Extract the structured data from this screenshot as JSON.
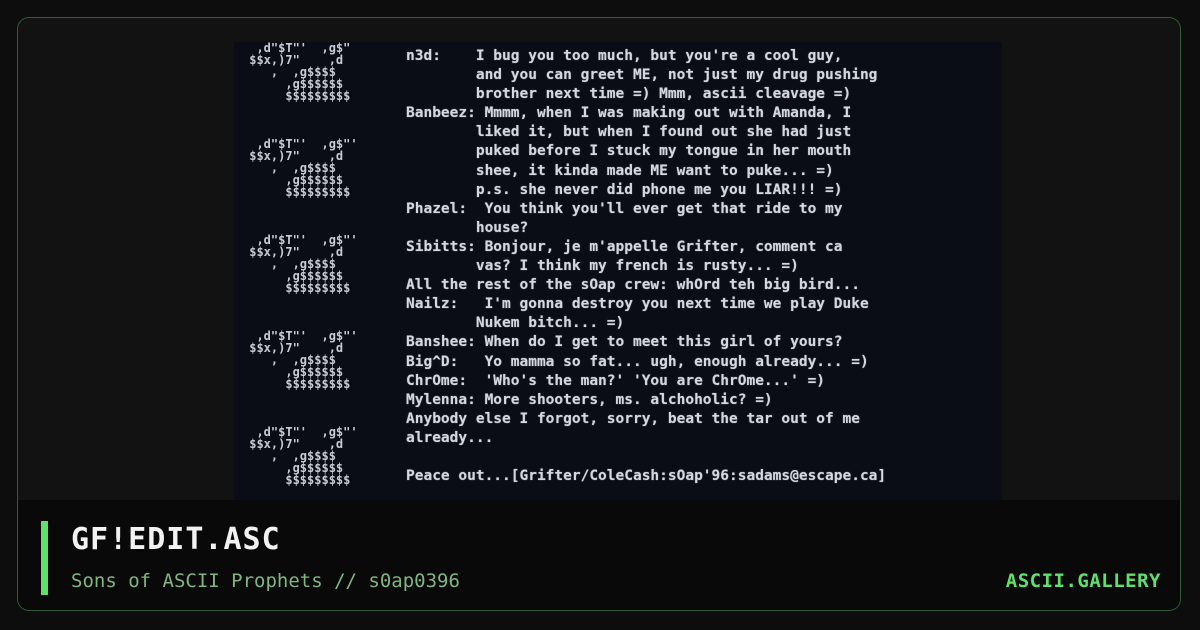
{
  "artwork": {
    "lines": [
      "n3d:    I bug you too much, but you're a cool guy,",
      "        and you can greet ME, not just my drug pushing",
      "        brother next time =) Mmm, ascii cleavage =)",
      "Banbeez: Mmmm, when I was making out with Amanda, I",
      "        liked it, but when I found out she had just",
      "        puked before I stuck my tongue in her mouth",
      "        shee, it kinda made ME want to puke... =)",
      "        p.s. she never did phone me you LIAR!!! =)",
      "Phazel:  You think you'll ever get that ride to my",
      "        house?",
      "Sibitts: Bonjour, je m'appelle Grifter, comment ca",
      "        vas? I think my french is rusty... =)",
      "All the rest of the sOap crew: whOrd teh big bird...",
      "Nailz:   I'm gonna destroy you next time we play Duke",
      "        Nukem bitch... =)",
      "Banshee: When do I get to meet this girl of yours?",
      "Big^D:   Yo mamma so fat... ugh, enough already... =)",
      "ChrOme:  'Who's the man?' 'You are ChrOme...' =)",
      "Mylenna: More shooters, ms. alchoholic? =)",
      "Anybody else I forgot, sorry, beat the tar out of me",
      "already...",
      "",
      "Peace out...[Grifter/ColeCash:sOap'96:sadams@escape.ca]"
    ]
  },
  "footer": {
    "title": "GF!EDIT.ASC",
    "subtitle": "Sons of ASCII Prophets // s0ap0396",
    "brand": "ASCII.GALLERY"
  },
  "colors": {
    "accent": "#5ee06a",
    "subtitle": "#7fb77f",
    "card_border": "#2e5c34",
    "art_background": "#0a0d16"
  }
}
